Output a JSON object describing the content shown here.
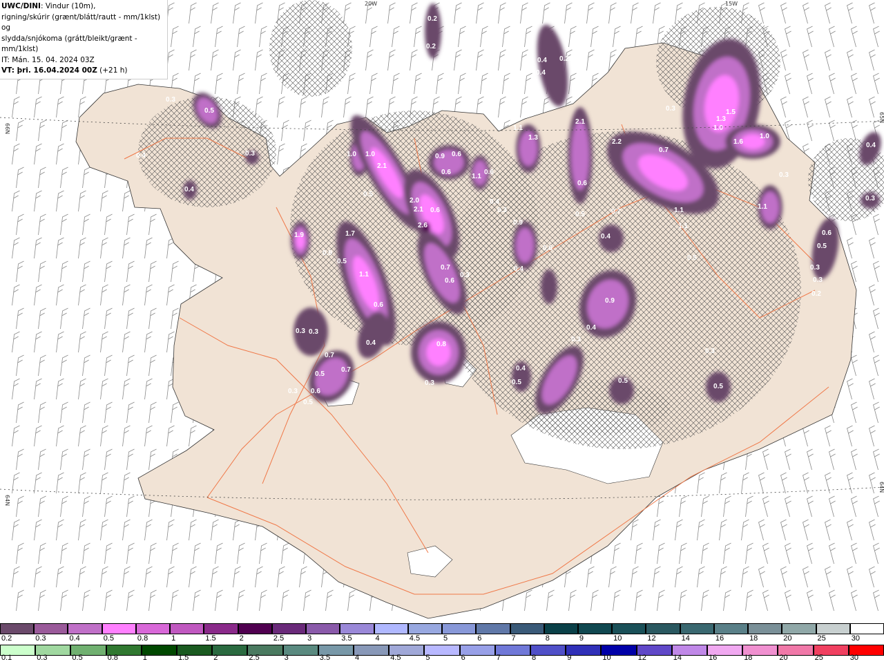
{
  "header": {
    "model": "UWC/DINI",
    "title_rest": ": Vindur (10m),",
    "line2": "rigning/skúrir (grænt/blátt/rautt - mm/1klst) og",
    "line3": "slydda/snjókoma (grátt/bleikt/grænt - mm/1klst)",
    "issue_time": "IT: Mán. 15. 04. 2024 03Z",
    "valid_label": "VT: þri. 16.04.2024 00Z",
    "valid_offset": "(+21 h)"
  },
  "grid_labels": {
    "lon_20w": "20W",
    "lon_15w": "15W",
    "lat_66n_left": "66N",
    "lat_64n_left": "64N",
    "lat_65n_right": "65N",
    "lat_64n_right": "64N"
  },
  "colors": {
    "land": "#f1e3d5",
    "road": "#f07848",
    "ocean": "#ffffff",
    "glacier": "#ffffff",
    "snow_light": "#6b4a6b",
    "snow_mid": "#c070c8",
    "snow_high": "#ff80ff",
    "snow_max": "#500050"
  },
  "precip_labels": [
    "0.3",
    "0.5",
    "0.4",
    "0.3",
    "0.4",
    "1.0",
    "1.0",
    "2.1",
    "0.5",
    "2.0",
    "2.1",
    "0.6",
    "2.6",
    "1.9",
    "1.7",
    "0.9",
    "0.5",
    "1.1",
    "0.7",
    "0.6",
    "0.3",
    "0.6",
    "0.3",
    "0.3",
    "0.4",
    "0.7",
    "0.7",
    "0.5",
    "0.3",
    "0.6",
    "0.5",
    "0.3",
    "0.8",
    "0.9",
    "0.6",
    "0.6",
    "1.1",
    "0.6",
    "0.2",
    "0.2",
    "0.4",
    "0.4",
    "0.2",
    "1.1",
    "1.3",
    "2.1",
    "0.6",
    "0.5",
    "2.2",
    "0.7",
    "0.7",
    "1.1",
    "1.1",
    "0.5",
    "0.3",
    "1.3",
    "1.5",
    "1.0",
    "1.6",
    "1.0",
    "0.4",
    "0.3",
    "1.1",
    "0.3",
    "0.4",
    "0.3",
    "0.9",
    "0.6",
    "0.4",
    "0.4",
    "0.9",
    "0.4",
    "0.3",
    "0.4",
    "0.5",
    "0.5",
    "0.3",
    "0.5",
    "0.6",
    "0.5",
    "0.3",
    "0.3",
    "0.2"
  ],
  "legend_snow": {
    "labels": [
      "0.2",
      "0.3",
      "0.4",
      "0.5",
      "0.8",
      "1",
      "1.5",
      "2",
      "2.5",
      "3",
      "3.5",
      "4",
      "4.5",
      "5",
      "6",
      "7",
      "8",
      "9",
      "10",
      "12",
      "14",
      "16",
      "18",
      "20",
      "25",
      "30"
    ],
    "colors": [
      "#6b4a6b",
      "#9a5a9a",
      "#c070c8",
      "#ff80ff",
      "#d868d8",
      "#c058c0",
      "#8a2a8a",
      "#500050",
      "#6a2a7a",
      "#8a5aaa",
      "#9a88d8",
      "#b0b8ff",
      "#98a8e0",
      "#8898d8",
      "#6078a8",
      "#3a5a78",
      "#0a4048",
      "#104850",
      "#1a5058",
      "#2a5860",
      "#3a6870",
      "#5a8088",
      "#7a9098",
      "#90a8a8",
      "#c8d0d0",
      "#ffffff"
    ]
  },
  "legend_rain": {
    "labels": [
      "0.1",
      "0.3",
      "0.5",
      "0.8",
      "1",
      "1.5",
      "2",
      "2.5",
      "3",
      "3.5",
      "4",
      "4.5",
      "5",
      "6",
      "7",
      "8",
      "9",
      "10",
      "12",
      "14",
      "16",
      "18",
      "20",
      "25",
      "30"
    ],
    "colors": [
      "#ccffcc",
      "#a0d8a0",
      "#70b070",
      "#307830",
      "#004800",
      "#1a5a20",
      "#2a6a40",
      "#4a7a60",
      "#5a8a80",
      "#7898a8",
      "#8898b8",
      "#a0a8d8",
      "#b8b8ff",
      "#98a0e8",
      "#7078d8",
      "#5050c8",
      "#3030b8",
      "#0000a8",
      "#6048c8",
      "#c088e8",
      "#f0a8f0",
      "#f090d0",
      "#f078a8",
      "#f04060",
      "#ff0000"
    ]
  }
}
